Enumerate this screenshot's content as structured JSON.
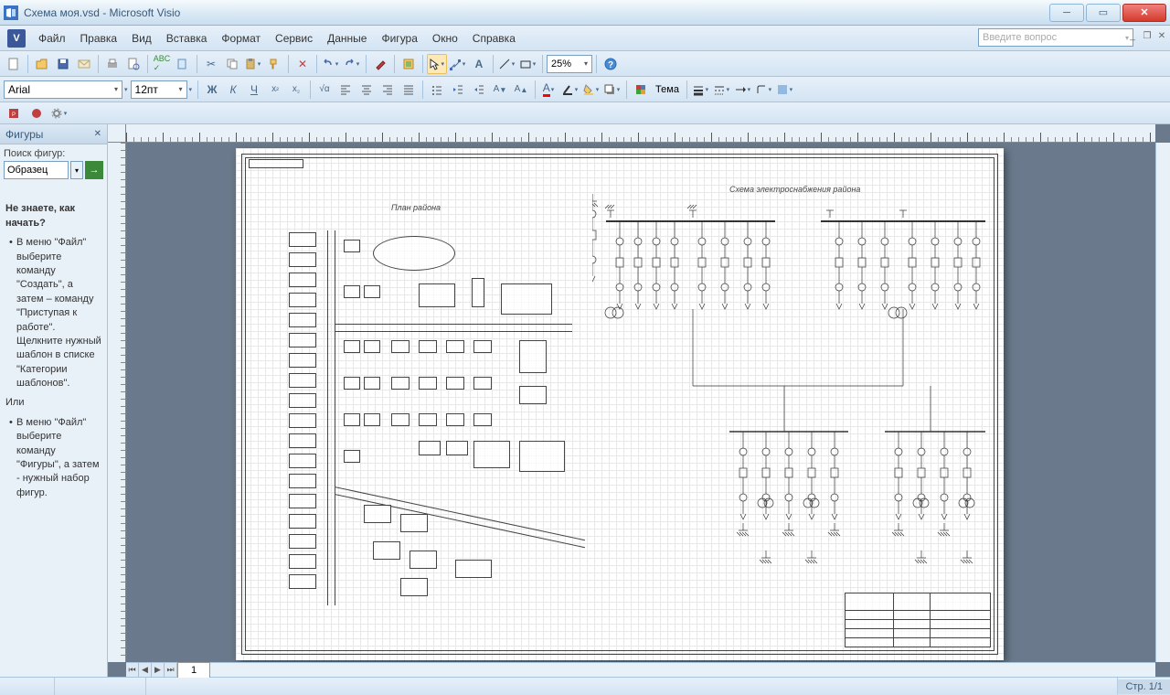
{
  "title": "Схема моя.vsd - Microsoft Visio",
  "menu": [
    "Файл",
    "Правка",
    "Вид",
    "Вставка",
    "Формат",
    "Сервис",
    "Данные",
    "Фигура",
    "Окно",
    "Справка"
  ],
  "question_placeholder": "Введите вопрос",
  "font": {
    "name": "Arial",
    "size": "12пт"
  },
  "zoom": "25%",
  "format_btns": {
    "bold": "Ж",
    "italic": "К",
    "underline": "Ч",
    "super": "x²",
    "sub": "x₂"
  },
  "theme_label": "Тема",
  "shapes": {
    "title": "Фигуры",
    "search_label": "Поиск фигур:",
    "search_value": "Образец",
    "help": {
      "heading": "Не знаете, как начать?",
      "p1": "В меню \"Файл\" выберите команду \"Создать\", а затем – команду \"Приступая к работе\". Щелкните нужный шаблон в списке \"Категории шаблонов\".",
      "or": "Или",
      "p2": "В меню \"Файл\" выберите команду \"Фигуры\", а затем - нужный набор фигур."
    }
  },
  "page_tab": "1",
  "status": {
    "page": "Стр. 1/1"
  },
  "diagram": {
    "title_left": "План района",
    "title_right": "Схема электроснабжения района"
  }
}
